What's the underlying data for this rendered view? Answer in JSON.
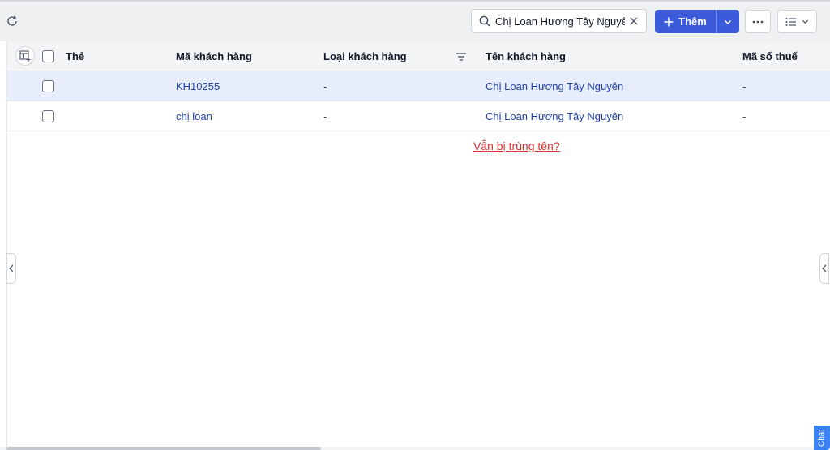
{
  "toolbar": {
    "refresh_icon": "refresh-icon",
    "search": {
      "value": "Chị Loan Hương Tây Nguyên",
      "placeholder": "",
      "icon": "search-icon",
      "clear_icon": "close-icon"
    },
    "add_button_label": "Thêm",
    "add_icon": "plus-icon",
    "more_icon": "ellipsis-icon",
    "view_icon": "list-icon"
  },
  "table": {
    "columns": {
      "tag": "Thẻ",
      "customer_code": "Mã khách hàng",
      "customer_type": "Loại khách hàng",
      "customer_name": "Tên khách hàng",
      "tax_code": "Mã số thuế"
    },
    "rows": [
      {
        "customer_code": "KH10255",
        "customer_type": "-",
        "customer_name": "Chị Loan Hương Tây Nguyên",
        "tax_code": "-",
        "selected": true
      },
      {
        "customer_code": "chị loan",
        "customer_type": "-",
        "customer_name": "Chị Loan Hương Tây Nguyên",
        "tax_code": "-",
        "selected": false
      }
    ]
  },
  "duplicate_note": "Vẫn bị trùng tên?",
  "chat_label": "Chat",
  "colors": {
    "primary": "#3b5bdb",
    "link": "#1d3faa",
    "warning": "#e03131",
    "selected_row": "#e8edfb"
  }
}
